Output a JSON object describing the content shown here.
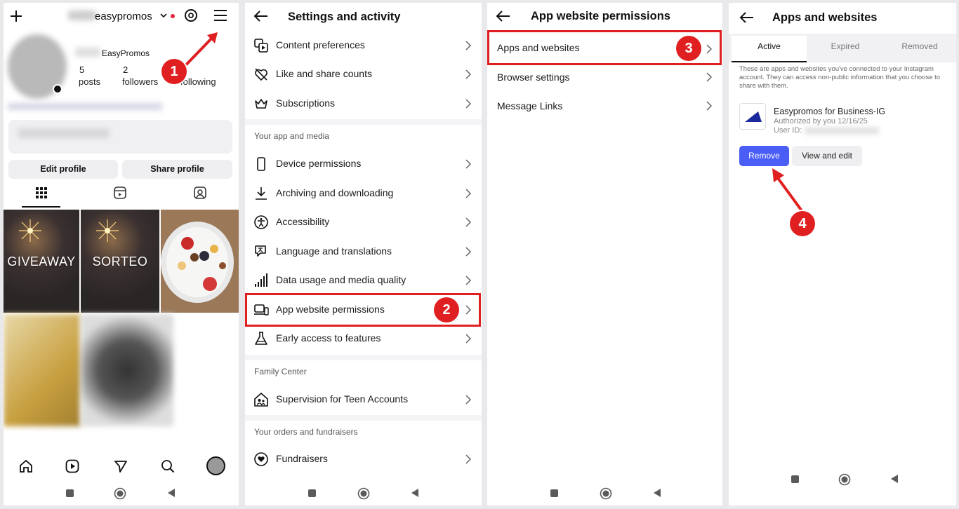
{
  "profile": {
    "username": "easypromos",
    "display_name": "EasyPromos",
    "posts_count": "5",
    "posts_label": "posts",
    "followers_count": "2",
    "followers_label": "followers",
    "following_label": "following",
    "edit_profile": "Edit profile",
    "share_profile": "Share profile",
    "tiles": [
      {
        "label": "GIVEAWAY"
      },
      {
        "label": "SORTEO"
      }
    ]
  },
  "settings": {
    "title": "Settings and activity",
    "items_top": [
      {
        "label": "Content preferences",
        "icon": "content-preferences-icon"
      },
      {
        "label": "Like and share counts",
        "icon": "heart-slash-icon"
      },
      {
        "label": "Subscriptions",
        "icon": "crown-icon"
      }
    ],
    "section_app_media": "Your app and media",
    "items_app": [
      {
        "label": "Device permissions",
        "icon": "phone-icon"
      },
      {
        "label": "Archiving and downloading",
        "icon": "download-icon"
      },
      {
        "label": "Accessibility",
        "icon": "accessibility-icon"
      },
      {
        "label": "Language and translations",
        "icon": "translate-icon"
      },
      {
        "label": "Data usage and media quality",
        "icon": "signal-icon"
      },
      {
        "label": "App website permissions",
        "icon": "devices-icon"
      },
      {
        "label": "Early access to features",
        "icon": "flask-icon"
      }
    ],
    "section_family": "Family Center",
    "items_family": [
      {
        "label": "Supervision for Teen Accounts",
        "icon": "house-people-icon"
      }
    ],
    "section_orders": "Your orders and fundraisers",
    "items_orders": [
      {
        "label": "Fundraisers",
        "icon": "fundraiser-icon"
      }
    ]
  },
  "app_permissions": {
    "title": "App website permissions",
    "items": [
      {
        "label": "Apps and websites"
      },
      {
        "label": "Browser settings"
      },
      {
        "label": "Message Links"
      }
    ]
  },
  "apps_websites": {
    "title": "Apps and websites",
    "tabs": [
      {
        "label": "Active"
      },
      {
        "label": "Expired"
      },
      {
        "label": "Removed"
      }
    ],
    "description": "These are apps and websites you've connected to your Instagram account. They can access non-public information that you choose to share with them.",
    "app": {
      "name": "Easypromos for Business-IG",
      "authorized": "Authorized by you 12/16/25",
      "user_id_label": "User ID:"
    },
    "remove": "Remove",
    "view_edit": "View and edit"
  },
  "steps": [
    "1",
    "2",
    "3",
    "4"
  ],
  "colors": {
    "highlight": "#e02020",
    "primary_button": "#4a5df5",
    "active_tab_border": "#111111"
  }
}
